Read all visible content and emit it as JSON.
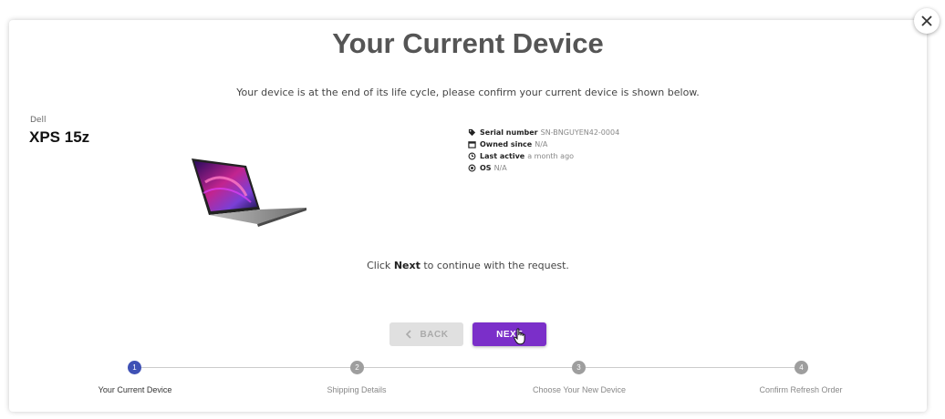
{
  "header": {
    "title": "Your Current Device"
  },
  "intro": {
    "message": "Your device is at the end of its life cycle, please confirm your current device is shown below."
  },
  "device": {
    "brand": "Dell",
    "model": "XPS 15z",
    "specs": [
      {
        "icon": "tag-icon",
        "label": "Serial number",
        "value": "SN-BNGUYEN42-0004"
      },
      {
        "icon": "calendar-icon",
        "label": "Owned since",
        "value": "N/A"
      },
      {
        "icon": "clock-icon",
        "label": "Last active",
        "value": "a month ago"
      },
      {
        "icon": "os-icon",
        "label": "OS",
        "value": "N/A"
      }
    ]
  },
  "instruction": {
    "prefix": "Click",
    "keyword": "Next",
    "suffix": "to continue with the request."
  },
  "actions": {
    "back_label": "BACK",
    "next_label": "NEXT"
  },
  "stepper": {
    "active_index": 0,
    "active_color": "#3f51b5",
    "inactive_color": "#9e9e9e",
    "steps": [
      {
        "number": "1",
        "label": "Your Current Device"
      },
      {
        "number": "2",
        "label": "Shipping Details"
      },
      {
        "number": "3",
        "label": "Choose Your New Device"
      },
      {
        "number": "4",
        "label": "Confirm Refresh Order"
      }
    ]
  },
  "colors": {
    "primary": "#7b2fc9",
    "title_text": "#555555"
  }
}
